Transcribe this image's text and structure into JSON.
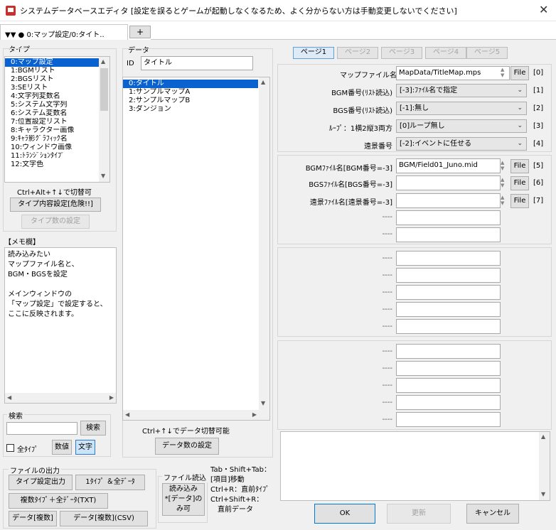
{
  "window": {
    "title": "システムデータベースエディタ [設定を誤るとゲームが起動しなくなるため、よく分からない方は手動変更しないでください]",
    "close_icon": "✕"
  },
  "top_tab": {
    "label": "▼▼ ● 0:マップ設定/0:タイト..",
    "plus": "+"
  },
  "type_panel": {
    "heading": "タイプ",
    "items": [
      "0:マップ設定",
      "1:BGMリスト",
      "2:BGSリスト",
      "3:SEリスト",
      "4:文字列変数名",
      "5:システム文字列",
      "6:システム変数名",
      "7:位置設定リスト",
      "8:キャラクター画像",
      "9:ｷｬﾗ影ｸﾞﾗﾌｨｯｸ名",
      "10:ウィンドウ画像",
      "11:ﾄﾗﾝｼﾞｼｮﾝﾀｲﾌﾟ",
      "12:文字色"
    ],
    "hint": "Ctrl+Alt+↑↓で切替可",
    "settings_button": "タイプ内容設定[危険!!]",
    "count_button": "タイプ数の設定"
  },
  "memo": {
    "heading": "【メモ欄】",
    "lines": [
      "読み込みたい",
      "マップファイル名と、",
      "BGM・BGSを設定",
      "",
      "メインウィンドウの",
      "「マップ設定」で設定すると、",
      "ここに反映されます。"
    ]
  },
  "search": {
    "heading": "検索",
    "input_value": "",
    "search_button": "検索",
    "all_types_label": "全ﾀｲﾌﾟ",
    "numeric_button": "数値",
    "text_button": "文字"
  },
  "file_output": {
    "heading": "ファイルの出力",
    "type_settings_button": "タイプ設定出力",
    "one_type_all_data_button": "1ﾀｲﾌﾟ ＆全ﾃﾞｰﾀ",
    "multi_type_button": "複数ﾀｲﾌﾟ＋全ﾃﾞｰﾀ(TXT)",
    "data_multi_button": "データ[複数]",
    "data_multi_csv_button": "データ[複数](CSV)"
  },
  "file_read": {
    "heading": "ファイル読込",
    "read_button_lines": [
      "読み込み",
      "*[データ]の",
      "み可"
    ]
  },
  "shortcuts": {
    "lines": [
      "Tab・Shift+Tab：",
      "[項目]移動",
      "Ctrl+R：直前ﾀｲﾌﾟ",
      "Ctrl+Shift+R：",
      "　直前データ"
    ]
  },
  "data_panel": {
    "heading": "データ",
    "id_label": "ID",
    "name_value": "タイトル",
    "items": [
      "0:タイトル",
      "1:サンプルマップA",
      "2:サンプルマップB",
      "3:ダンジョン"
    ],
    "hint": "Ctrl+↑↓でデータ切替可能",
    "count_button": "データ数の設定"
  },
  "pages": [
    "ページ1",
    "ページ2",
    "ページ3",
    "ページ4",
    "ページ5"
  ],
  "fields_group1": [
    {
      "label": "マップファイル名",
      "kind": "text",
      "value": "MapData/TitleMap.mps",
      "button": "File",
      "index": "[0]"
    },
    {
      "label": "BGM番号(ﾘｽﾄ読込)",
      "kind": "combo",
      "value": "[-3]:ﾌｧｲﾙ名で指定",
      "index": "[1]"
    },
    {
      "label": "BGS番号(ﾘｽﾄ読込)",
      "kind": "combo",
      "value": "[-1]:無し",
      "index": "[2]"
    },
    {
      "label": "ﾙｰﾌﾟ：1横2縦3両方",
      "kind": "combo",
      "value": "[0]ループ無し",
      "index": "[3]"
    },
    {
      "label": "遠景番号",
      "kind": "combo",
      "value": "[-2]:イベントに任せる",
      "index": "[4]"
    }
  ],
  "fields_group2": [
    {
      "label": "BGMﾌｧｲﾙ名[BGM番号=-3]",
      "value": "BGM/Field01_Juno.mid",
      "button": "File",
      "index": "[5]"
    },
    {
      "label": "BGSﾌｧｲﾙ名[BGS番号=-3]",
      "value": "",
      "button": "File",
      "index": "[6]"
    },
    {
      "label": "遠景ﾌｧｲﾙ名[遠景番号=-3]",
      "value": "",
      "button": "File",
      "index": "[7]"
    },
    {
      "label": "----",
      "value": ""
    },
    {
      "label": "----",
      "value": ""
    }
  ],
  "fields_group3": [
    "----",
    "----",
    "----",
    "----",
    "----"
  ],
  "fields_group4": [
    "----",
    "----",
    "----",
    "----",
    "----"
  ],
  "footer": {
    "ok": "OK",
    "update": "更新",
    "cancel": "キャンセル"
  }
}
